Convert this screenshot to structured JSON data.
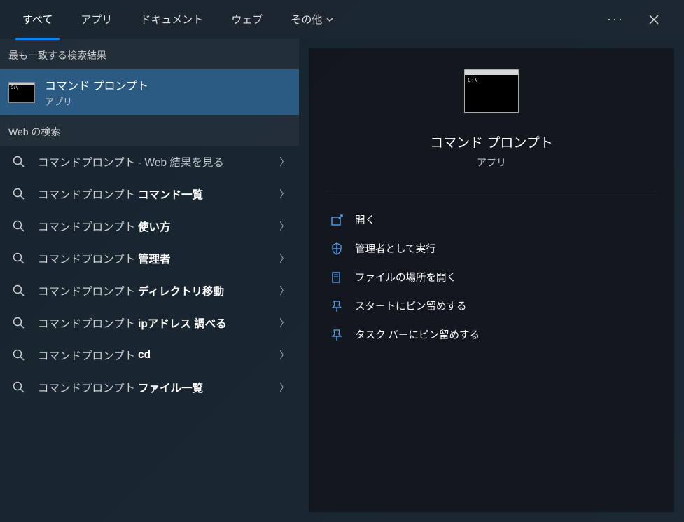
{
  "tabs": {
    "all": "すべて",
    "apps": "アプリ",
    "documents": "ドキュメント",
    "web": "ウェブ",
    "more": "その他"
  },
  "sections": {
    "best_match": "最も一致する検索結果",
    "web_search": "Web の検索"
  },
  "best_match": {
    "title": "コマンド プロンプト",
    "subtitle": "アプリ"
  },
  "web_results": [
    {
      "prefix": "コマンドプロンプト",
      "suffix": "- Web 結果を見る",
      "bold": false
    },
    {
      "prefix": "コマンドプロンプト",
      "suffix": "コマンド一覧",
      "bold": true
    },
    {
      "prefix": "コマンドプロンプト",
      "suffix": "使い方",
      "bold": true
    },
    {
      "prefix": "コマンドプロンプト",
      "suffix": "管理者",
      "bold": true
    },
    {
      "prefix": "コマンドプロンプト",
      "suffix": "ディレクトリ移動",
      "bold": true
    },
    {
      "prefix": "コマンドプロンプト",
      "suffix": "ipアドレス 調べる",
      "bold": true
    },
    {
      "prefix": "コマンドプロンプト",
      "suffix": "cd",
      "bold": true
    },
    {
      "prefix": "コマンドプロンプト",
      "suffix": "ファイル一覧",
      "bold": true
    }
  ],
  "preview": {
    "title": "コマンド プロンプト",
    "subtitle": "アプリ"
  },
  "actions": {
    "open": "開く",
    "run_admin": "管理者として実行",
    "open_location": "ファイルの場所を開く",
    "pin_start": "スタートにピン留めする",
    "pin_taskbar": "タスク バーにピン留めする"
  }
}
